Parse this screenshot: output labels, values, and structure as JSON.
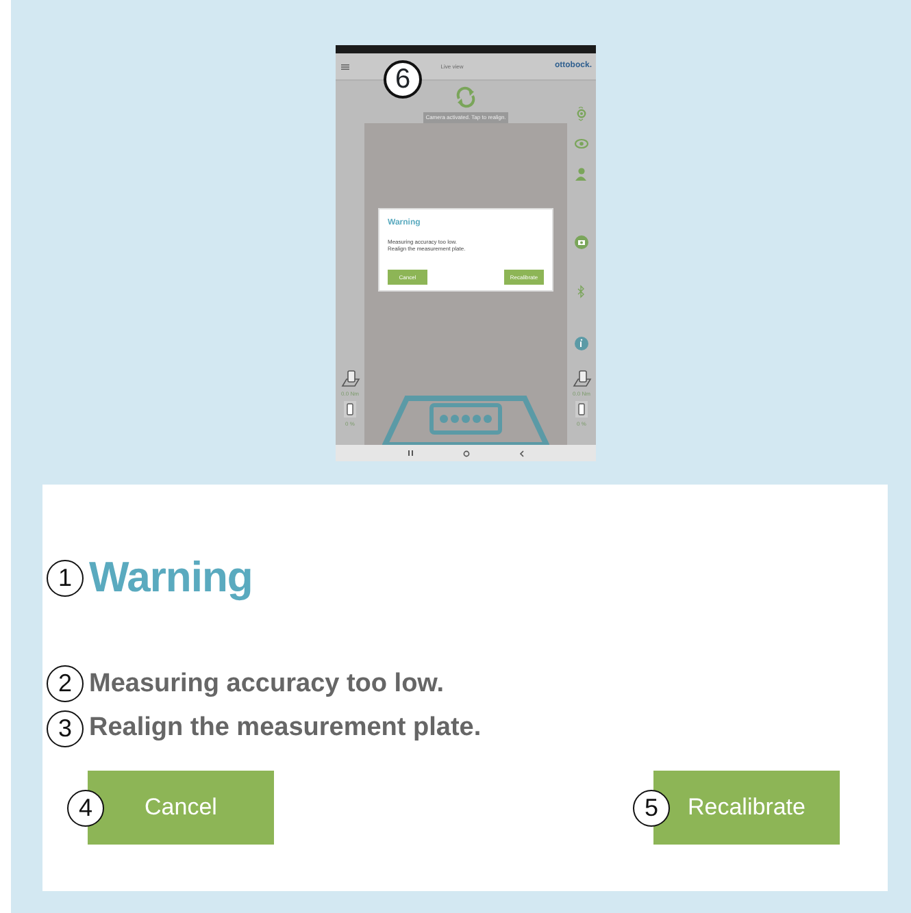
{
  "tablet": {
    "header": {
      "title": "Live view",
      "logo": "ottobock."
    },
    "banner": "Camera activated. Tap to realign.",
    "callout": "6",
    "dialog": {
      "title": "Warning",
      "lines": [
        "Measuring accuracy too low.",
        "Realign the measurement plate."
      ],
      "buttons": [
        "Cancel",
        "Recalibrate"
      ]
    },
    "left_readings": [
      "0.0 Nm",
      "0 %"
    ],
    "right_readings": [
      "0.0 Nm",
      "0 %"
    ]
  },
  "detail": {
    "title": {
      "callout": "1",
      "text": "Warning"
    },
    "lines": [
      {
        "callout": "2",
        "text": "Measuring accuracy too low."
      },
      {
        "callout": "3",
        "text": "Realign the measurement plate."
      }
    ],
    "buttons": [
      {
        "callout": "4",
        "label": "Cancel"
      },
      {
        "callout": "5",
        "label": "Recalibrate"
      }
    ]
  }
}
